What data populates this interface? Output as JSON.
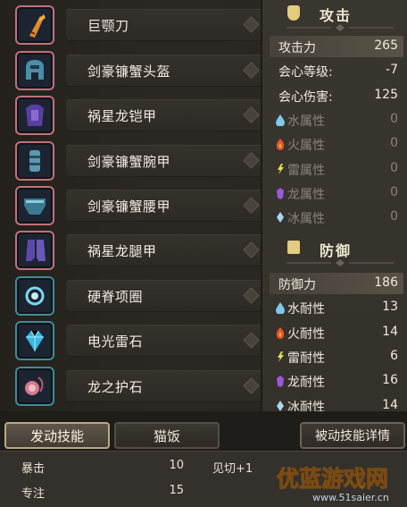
{
  "equipment": [
    {
      "name": "巨颚刀",
      "icon": "great-sword-icon",
      "frame": "rare"
    },
    {
      "name": "剑豪镰蟹头盔",
      "icon": "helmet-icon",
      "frame": "rare"
    },
    {
      "name": "祸星龙铠甲",
      "icon": "chest-armor-icon",
      "frame": "rare"
    },
    {
      "name": "剑豪镰蟹腕甲",
      "icon": "arm-armor-icon",
      "frame": "rare"
    },
    {
      "name": "剑豪镰蟹腰甲",
      "icon": "waist-armor-icon",
      "frame": "rare"
    },
    {
      "name": "祸星龙腿甲",
      "icon": "leg-armor-icon",
      "frame": "rare"
    },
    {
      "name": "硬脊项圈",
      "icon": "charm-icon",
      "frame": "teal"
    },
    {
      "name": "电光雷石",
      "icon": "gem-icon",
      "frame": "teal"
    },
    {
      "name": "龙之护石",
      "icon": "talisman-icon",
      "frame": "teal"
    }
  ],
  "attack": {
    "title": "攻击",
    "stats": [
      {
        "label": "攻击力",
        "value": "265",
        "icon": "",
        "highlight": true,
        "dim": false
      },
      {
        "label": "会心等级:",
        "value": "-7",
        "icon": "",
        "highlight": false,
        "dim": false
      },
      {
        "label": "会心伤害:",
        "value": "125",
        "icon": "",
        "highlight": false,
        "dim": false
      },
      {
        "label": "水属性",
        "value": "0",
        "icon": "water-drop-icon",
        "highlight": false,
        "dim": true
      },
      {
        "label": "火属性",
        "value": "0",
        "icon": "fire-icon",
        "highlight": false,
        "dim": true
      },
      {
        "label": "雷属性",
        "value": "0",
        "icon": "thunder-icon",
        "highlight": false,
        "dim": true
      },
      {
        "label": "龙属性",
        "value": "0",
        "icon": "dragon-icon",
        "highlight": false,
        "dim": true
      },
      {
        "label": "冰属性",
        "value": "0",
        "icon": "ice-icon",
        "highlight": false,
        "dim": true
      }
    ]
  },
  "defense": {
    "title": "防御",
    "stats": [
      {
        "label": "防御力",
        "value": "186",
        "icon": "",
        "highlight": true,
        "dim": false
      },
      {
        "label": "水耐性",
        "value": "13",
        "icon": "water-drop-icon",
        "highlight": false,
        "dim": false
      },
      {
        "label": "火耐性",
        "value": "14",
        "icon": "fire-icon",
        "highlight": false,
        "dim": false
      },
      {
        "label": "雷耐性",
        "value": "6",
        "icon": "thunder-icon",
        "highlight": false,
        "dim": false
      },
      {
        "label": "龙耐性",
        "value": "16",
        "icon": "dragon-icon",
        "highlight": false,
        "dim": false
      },
      {
        "label": "冰耐性",
        "value": "14",
        "icon": "ice-icon",
        "highlight": false,
        "dim": false
      }
    ]
  },
  "tabs": {
    "active_skills": "发动技能",
    "cat_food": "猫饭",
    "passive_skill_details": "被动技能详情"
  },
  "skills": [
    {
      "name": "暴击",
      "value": "10",
      "effect": "见切+1"
    },
    {
      "name": "专注",
      "value": "15",
      "effect": ""
    }
  ],
  "watermark": {
    "logo_text": "优蓝游戏网",
    "url": "www.51saier.cn"
  },
  "colors": {
    "rare_frame": "#c1707a",
    "teal_frame": "#3d8c96",
    "value_highlight": "#f0eadc",
    "dim_text": "#8a847a"
  }
}
